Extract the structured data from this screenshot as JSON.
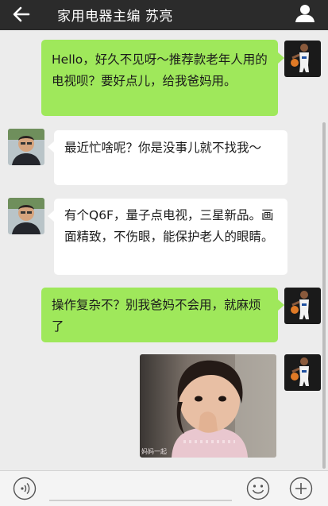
{
  "header": {
    "title": "家用电器主编 苏亮",
    "back_icon": "arrow-left-icon",
    "profile_icon": "person-icon"
  },
  "messages": [
    {
      "side": "right",
      "type": "text",
      "text": "Hello，好久不见呀～推荐款老年人用的电视呗？要好点儿，给我爸妈用。"
    },
    {
      "side": "left",
      "type": "text",
      "text": "最近忙啥呢？你是没事儿就不找我～"
    },
    {
      "side": "left",
      "type": "text",
      "text": "有个Q6F，量子点电视，三星新品。画面精致，不伤眼，能保护老人的眼睛。"
    },
    {
      "side": "right",
      "type": "text",
      "text": "操作复杂不？别我爸妈不会用，就麻烦了"
    },
    {
      "side": "right",
      "type": "image",
      "caption": "妈妈一起"
    }
  ],
  "bottom_bar": {
    "voice_icon": "voice-icon",
    "emoji_icon": "emoji-icon",
    "plus_icon": "plus-icon"
  },
  "colors": {
    "header_bg": "#2b2b2b",
    "chat_bg": "#ececec",
    "outgoing_bubble": "#9fe85b",
    "incoming_bubble": "#ffffff"
  }
}
